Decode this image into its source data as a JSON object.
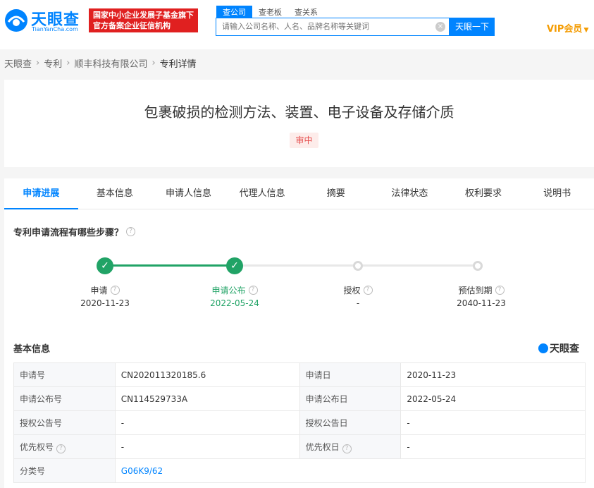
{
  "header": {
    "logo_text": "天眼查",
    "logo_sub": "TianYanCha.com",
    "banner_line1": "国家中小企业发展子基金旗下",
    "banner_line2": "官方备案企业征信机构",
    "search_tabs": [
      "查公司",
      "查老板",
      "查关系"
    ],
    "search_placeholder": "请输入公司名称、人名、品牌名称等关键词",
    "search_button": "天眼一下",
    "vip_label": "VIP会员"
  },
  "breadcrumb": [
    "天眼查",
    "专利",
    "顺丰科技有限公司",
    "专利详情"
  ],
  "patent": {
    "title": "包裹破损的检测方法、装置、电子设备及存储介质",
    "status": "审中"
  },
  "tabs": [
    "申请进展",
    "基本信息",
    "申请人信息",
    "代理人信息",
    "摘要",
    "法律状态",
    "权利要求",
    "说明书"
  ],
  "progress": {
    "heading": "专利申请流程有哪些步骤？",
    "steps": [
      {
        "label": "申请",
        "date": "2020-11-23",
        "done": true
      },
      {
        "label": "申请公布",
        "date": "2022-05-24",
        "done": true
      },
      {
        "label": "授权",
        "date": "-",
        "done": false
      },
      {
        "label": "预估到期",
        "date": "2040-11-23",
        "done": false
      }
    ]
  },
  "basic_info": {
    "heading": "基本信息",
    "brand": "天眼查",
    "rows": [
      {
        "k1": "申请号",
        "v1": "CN202011320185.6",
        "k2": "申请日",
        "v2": "2020-11-23"
      },
      {
        "k1": "申请公布号",
        "v1": "CN114529733A",
        "k2": "申请公布日",
        "v2": "2022-05-24"
      },
      {
        "k1": "授权公告号",
        "v1": "-",
        "k2": "授权公告日",
        "v2": "-"
      },
      {
        "k1": "优先权号",
        "v1": "-",
        "k2": "优先权日",
        "v2": "-"
      },
      {
        "k1": "分类号",
        "v1": "G06K9/62"
      }
    ]
  },
  "colors": {
    "accent": "#0084ff",
    "done": "#21a366",
    "status_red": "#e54b4b",
    "vip": "#f49b00"
  }
}
